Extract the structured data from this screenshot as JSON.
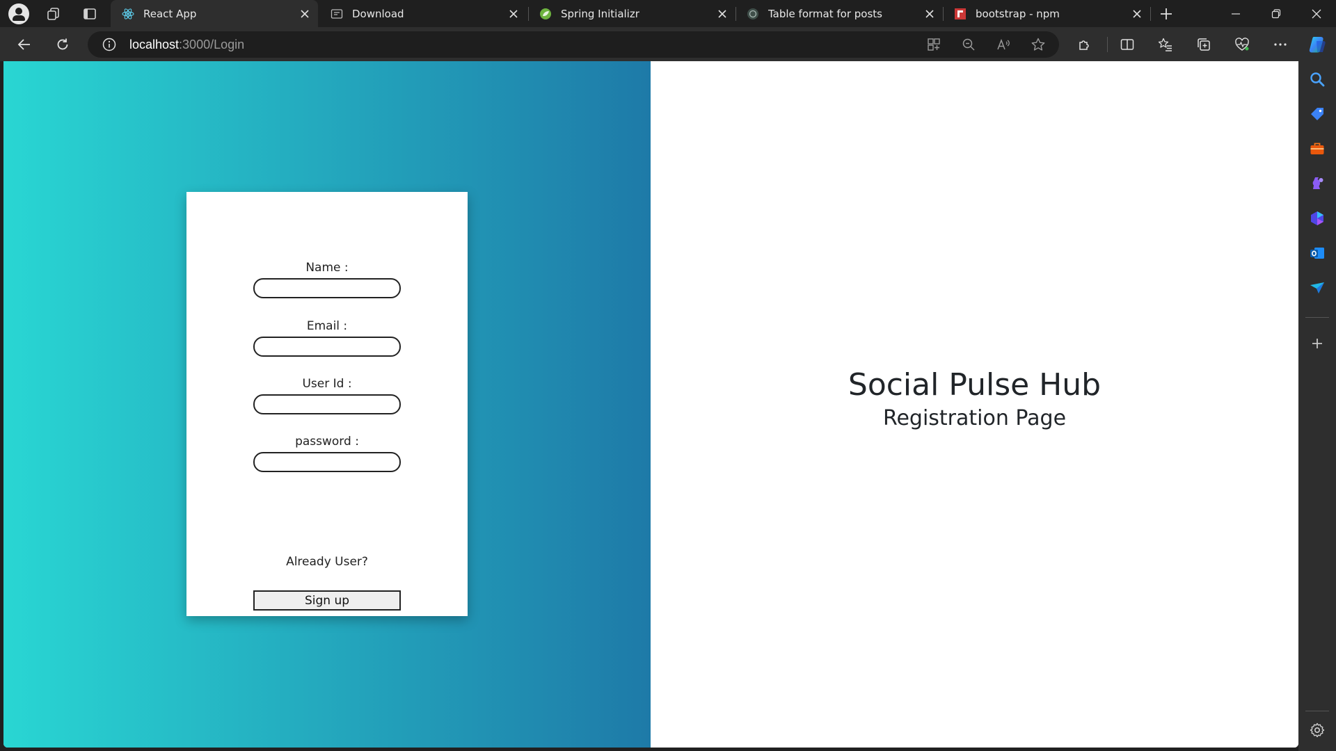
{
  "browser": {
    "tabs": [
      {
        "title": "React App",
        "icon": "react-icon",
        "active": true
      },
      {
        "title": "Download",
        "icon": "download-page-icon",
        "active": false
      },
      {
        "title": "Spring Initializr",
        "icon": "spring-leaf-icon",
        "active": false
      },
      {
        "title": "Table format for posts",
        "icon": "chatgpt-icon",
        "active": false
      },
      {
        "title": "bootstrap - npm",
        "icon": "npm-icon",
        "active": false
      }
    ],
    "address": {
      "host": "localhost",
      "rest": ":3000/Login"
    },
    "colors": {
      "frame": "#1f1f1f",
      "toolbar": "#2e2e2e",
      "omnibox": "#1e1e1e"
    }
  },
  "page": {
    "form": {
      "name_label": "Name :",
      "email_label": "Email :",
      "userid_label": "User Id :",
      "password_label": "password :",
      "already_user": "Already User?",
      "signup_label": "Sign up"
    },
    "hero": {
      "title": "Social Pulse Hub",
      "subtitle": "Registration Page"
    },
    "colors": {
      "gradient_start": "#29d6d3",
      "gradient_end": "#1e7aa8",
      "text": "#212529"
    }
  }
}
